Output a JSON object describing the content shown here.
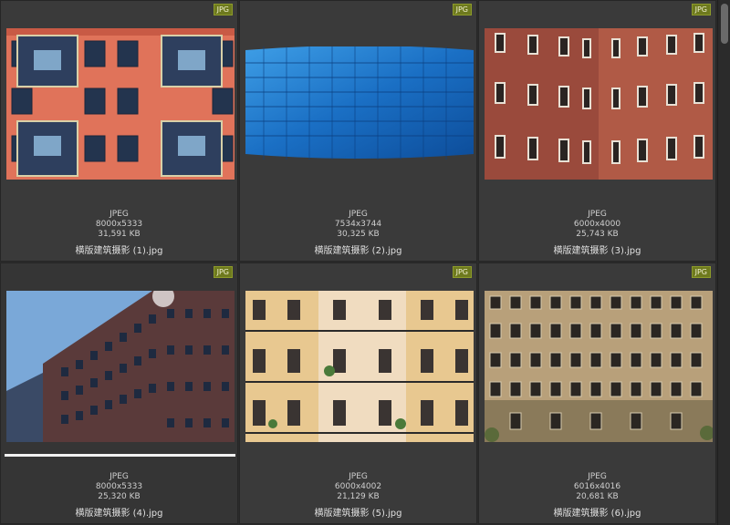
{
  "window": {
    "background": "#2b2b2b"
  },
  "thumbnails": [
    {
      "badge": "JPG",
      "format": "JPEG",
      "dimensions": "8000x5333",
      "size": "31,591 KB",
      "filename": "横版建筑摄影 (1).jpg",
      "icon": "building-photo-red-facade"
    },
    {
      "badge": "JPG",
      "format": "JPEG",
      "dimensions": "7534x3744",
      "size": "30,325 KB",
      "filename": "横版建筑摄影 (2).jpg",
      "icon": "building-photo-glass-facade"
    },
    {
      "badge": "JPG",
      "format": "JPEG",
      "dimensions": "6000x4000",
      "size": "25,743 KB",
      "filename": "横版建筑摄影 (3).jpg",
      "icon": "building-photo-brick-corner"
    },
    {
      "badge": "JPG",
      "format": "JPEG",
      "dimensions": "8000x5333",
      "size": "25,320 KB",
      "filename": "横版建筑摄影 (4).jpg",
      "icon": "building-photo-modern-block"
    },
    {
      "badge": "JPG",
      "format": "JPEG",
      "dimensions": "6000x4002",
      "size": "21,129 KB",
      "filename": "横版建筑摄影 (5).jpg",
      "icon": "building-photo-balconies"
    },
    {
      "badge": "JPG",
      "format": "JPEG",
      "dimensions": "6016x4016",
      "size": "20,681 KB",
      "filename": "横版建筑摄影 (6).jpg",
      "icon": "building-photo-old-facade"
    }
  ],
  "colors": {
    "badge": "#6e7a1e",
    "cell": "#3a3a3a",
    "text": "#cfcfcf"
  }
}
